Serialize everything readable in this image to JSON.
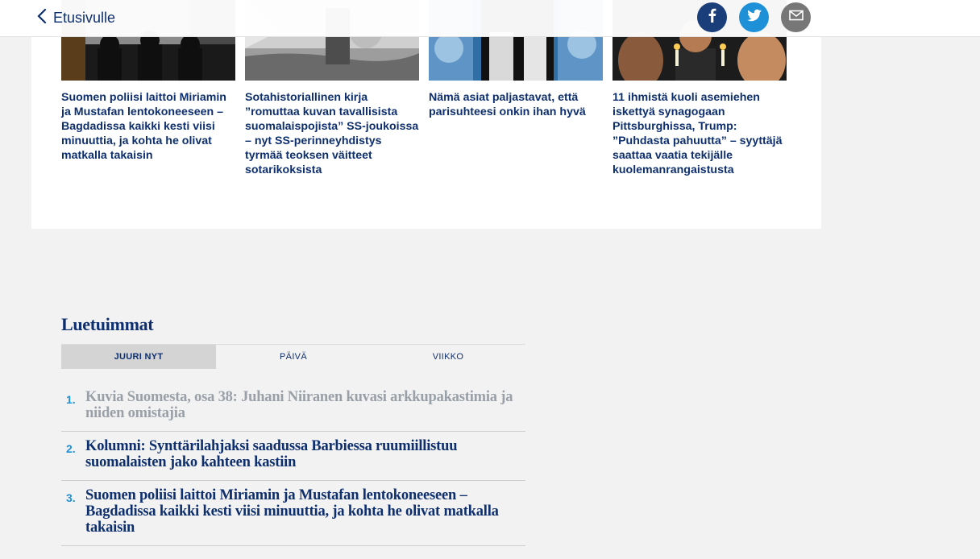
{
  "header": {
    "back_label": "Etusivulle"
  },
  "share": {
    "facebook": "facebook-icon",
    "twitter": "twitter-icon",
    "email": "email-icon"
  },
  "cards": [
    {
      "title": "Suomen poliisi laittoi Miriamin ja Mustafan lentokoneeseen – Bagdadissa kaikki kesti viisi minuuttia, ja kohta he olivat matkalla takaisin"
    },
    {
      "title": "Sotahistoriallinen kirja ”romuttaa kuvan tavallisista suomalaispojista” SS-joukoissa – nyt SS-perinneyhdistys tyrmää teoksen väitteet sotarikoksista"
    },
    {
      "title": "Nämä asiat paljastavat, että parisuhteesi onkin ihan hyvä"
    },
    {
      "title": "11 ihmistä kuoli asemiehen iskettyä synagogaan Pittsburghissa, Trump: ”Puhdasta pahuutta” – syyttäjä saattaa vaatia tekijälle kuolemanrangaistusta"
    }
  ],
  "most_read": {
    "heading": "Luetuimmat",
    "tabs": [
      "JUURI NYT",
      "PÄIVÄ",
      "VIIKKO"
    ],
    "active_tab": "JUURI NYT",
    "items": [
      {
        "num": "1.",
        "title": "Kuvia Suomesta, osa 38: Juhani Niiranen kuvasi arkkupakastimia ja niiden omistajia"
      },
      {
        "num": "2.",
        "title": "Kolumni:  Synttärilahjaksi saadussa Barbiessa ruumiillistuu suomalaisten jako kahteen kastiin"
      },
      {
        "num": "3.",
        "title": "Suomen poliisi laittoi Miriamin ja Mustafan lentokoneeseen – Bagdadissa kaikki kesti viisi minuuttia, ja kohta he olivat matkalla takaisin"
      }
    ]
  },
  "colors": {
    "brand": "#0e2f6e",
    "accent": "#1e90d8",
    "read": "#9aa0a8"
  }
}
